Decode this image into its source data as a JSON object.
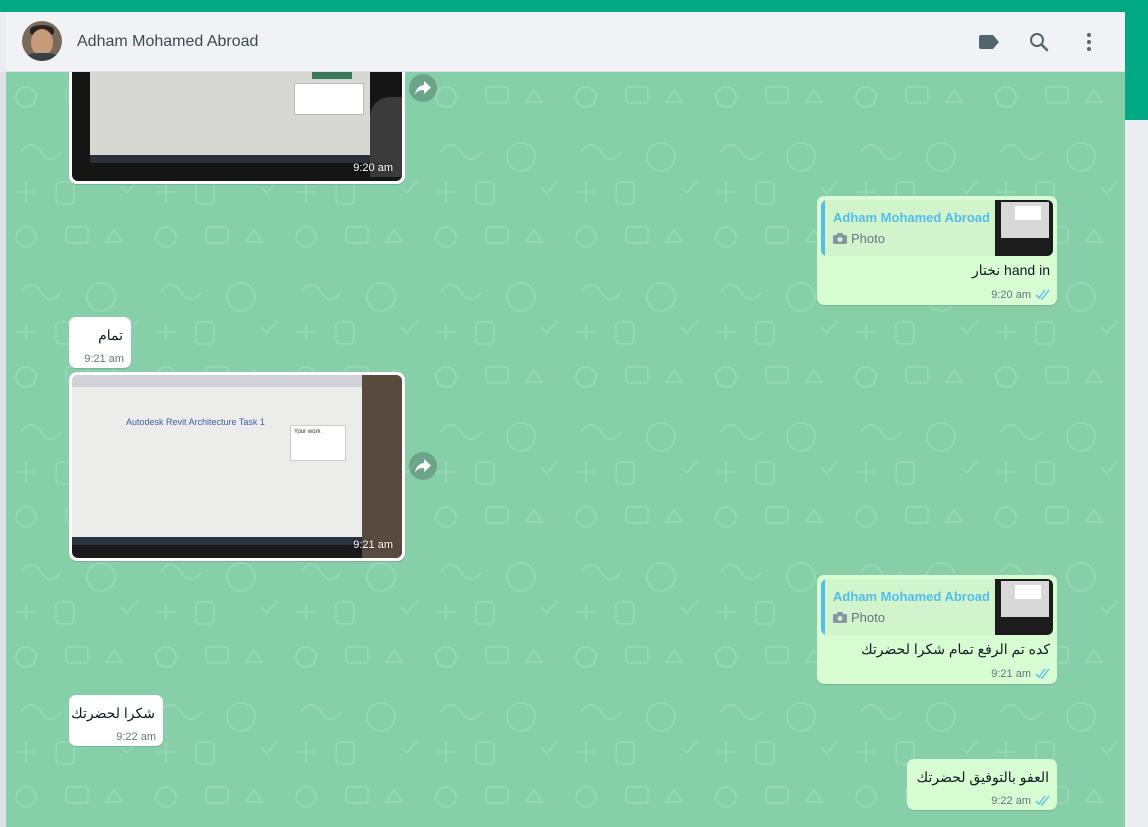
{
  "header": {
    "contact_name": "Adham Mohamed Abroad",
    "icons": [
      "label-icon",
      "search-icon",
      "menu-icon"
    ]
  },
  "colors": {
    "brand": "#00a884",
    "chat_bg": "#86cfa8",
    "incoming": "#ffffff",
    "outgoing": "#d9fdd3",
    "quote_name": "#53bdeb",
    "read_ticks": "#53bdeb"
  },
  "messages": [
    {
      "type": "image",
      "direction": "in",
      "time": "9:20 am"
    },
    {
      "type": "reply",
      "direction": "out",
      "quoted_name": "Adham Mohamed Abroad",
      "quoted_type": "Photo",
      "text": "نختار hand in",
      "time": "9:20 am",
      "status": "read"
    },
    {
      "type": "text",
      "direction": "in",
      "text": "تمام",
      "time": "9:21 am"
    },
    {
      "type": "image",
      "direction": "in",
      "time": "9:21 am",
      "screen_title": "Autodesk Revit Architecture Task 1",
      "side_panel": "Your work"
    },
    {
      "type": "reply",
      "direction": "out",
      "quoted_name": "Adham Mohamed Abroad",
      "quoted_type": "Photo",
      "text": "كده تم الرفع تمام شكرا لحضرتك",
      "time": "9:21 am",
      "status": "read"
    },
    {
      "type": "text",
      "direction": "in",
      "text": "شكرا لحضرتك",
      "time": "9:22 am"
    },
    {
      "type": "text",
      "direction": "out",
      "text": "العفو بالتوفيق لحضرتك",
      "time": "9:22 am",
      "status": "read"
    }
  ]
}
